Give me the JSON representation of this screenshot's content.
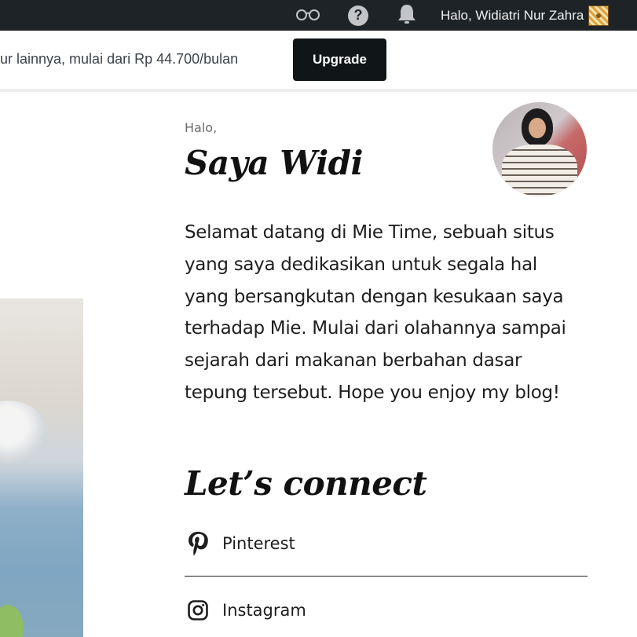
{
  "admin_bar": {
    "reader_icon": "reader-glasses-icon",
    "help_icon": "help-icon",
    "help_glyph": "?",
    "notifications_icon": "bell-icon",
    "greeting": "Halo, Widiatri Nur Zahra"
  },
  "upgrade_banner": {
    "text": "ur lainnya, mulai dari Rp 44.700/bulan",
    "button_label": "Upgrade"
  },
  "about": {
    "greeting": "Halo,",
    "headline": "Saya Widi",
    "intro_lines": [
      "Selamat datang di Mie Time, sebuah situs",
      "yang saya dedikasikan untuk segala hal",
      "yang bersangkutan dengan kesukaan saya",
      "terhadap Mie. Mulai dari olahannya sampai",
      "sejarah dari makanan berbahan dasar",
      "tepung tersebut. Hope you enjoy my blog!"
    ]
  },
  "connect": {
    "title": "Let’s connect",
    "links": [
      {
        "label": "Pinterest",
        "icon": "pinterest-icon"
      },
      {
        "label": "Instagram",
        "icon": "instagram-icon"
      }
    ]
  },
  "colors": {
    "admin_bar_bg": "#1d2327",
    "upgrade_button_bg": "#101517",
    "text": "#1e1e1e"
  }
}
